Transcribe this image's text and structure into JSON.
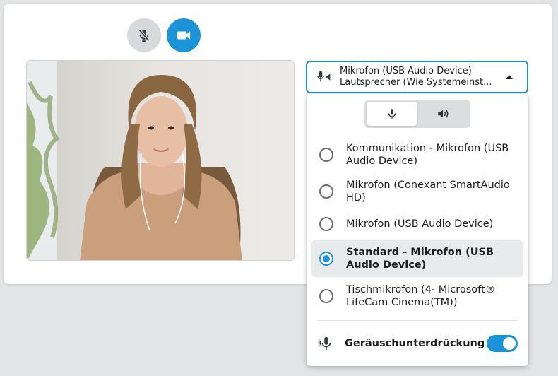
{
  "controls": {
    "mic_icon": "microphone-muted-icon",
    "camera_icon": "video-camera-icon",
    "accent_color": "#1a94d8"
  },
  "device_select": {
    "microphone": "Mikrofon (USB Audio Device)",
    "speaker": "Lautsprecher (Wie Systemeinst...",
    "icon": "microphone-speaker-icon"
  },
  "dropdown": {
    "tabs": [
      {
        "icon": "microphone-icon",
        "active": true
      },
      {
        "icon": "speaker-icon",
        "active": false
      }
    ],
    "options": [
      {
        "label": "Kommunikation - Mikrofon (USB Audio Device)",
        "selected": false
      },
      {
        "label": "Mikrofon (Conexant SmartAudio HD)",
        "selected": false
      },
      {
        "label": "Mikrofon (USB Audio Device)",
        "selected": false
      },
      {
        "label": "Standard - Mikrofon (USB Audio Device)",
        "selected": true
      },
      {
        "label": "Tischmikrofon (4- Microsoft® LifeCam Cinema(TM))",
        "selected": false
      }
    ],
    "noise_suppression": {
      "label": "Geräuschunterdrückung",
      "enabled": true
    }
  }
}
